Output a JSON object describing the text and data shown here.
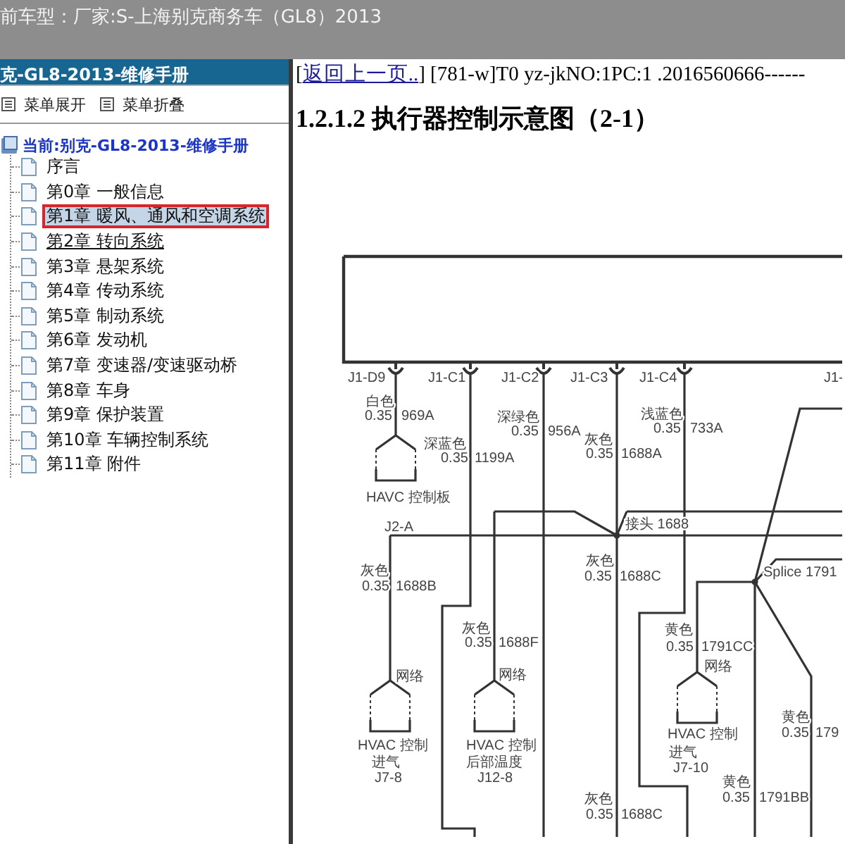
{
  "header": {
    "title": "前车型：厂家:S-上海别克商务车（GL8）2013"
  },
  "sidebar": {
    "title": "克-GL8-2013-维修手册",
    "toolbar": [
      {
        "label": "菜单展开"
      },
      {
        "label": "菜单折叠"
      }
    ],
    "tree": {
      "label": "当前:别克-GL8-2013-维修手册",
      "children": [
        {
          "label": "序言",
          "selected": false,
          "hovered": false
        },
        {
          "label": "第0章  一般信息",
          "selected": false,
          "hovered": false
        },
        {
          "label": "第1章  暖风、通风和空调系统",
          "selected": true,
          "hovered": false
        },
        {
          "label": "第2章  转向系统",
          "selected": false,
          "hovered": true
        },
        {
          "label": "第3章  悬架系统",
          "selected": false,
          "hovered": false
        },
        {
          "label": "第4章  传动系统",
          "selected": false,
          "hovered": false
        },
        {
          "label": "第5章  制动系统",
          "selected": false,
          "hovered": false
        },
        {
          "label": "第6章  发动机",
          "selected": false,
          "hovered": false
        },
        {
          "label": "第7章  变速器/变速驱动桥",
          "selected": false,
          "hovered": false
        },
        {
          "label": "第8章  车身",
          "selected": false,
          "hovered": false
        },
        {
          "label": "第9章  保护装置",
          "selected": false,
          "hovered": false
        },
        {
          "label": "第10章  车辆控制系统",
          "selected": false,
          "hovered": false
        },
        {
          "label": "第11章  附件",
          "selected": false,
          "hovered": false
        }
      ]
    }
  },
  "content": {
    "prefix": "[",
    "back_link": "返回上一页..",
    "ref": "] [781-w]T0 yz-jkNO:1PC:1 .2016560666------",
    "heading": "1.2.1.2 执行器控制示意图（2-1）",
    "diagram": {
      "labels": [
        "J1-D9",
        "J1-C1",
        "J1-C2",
        "J1-C3",
        "J1-C4",
        "J1-",
        "白色",
        "0.35",
        "969A",
        "深蓝色",
        "0.35",
        "1199A",
        "深绿色",
        "0.35",
        "956A",
        "灰色",
        "0.35",
        "1688A",
        "浅蓝色",
        "0.35",
        "733A",
        "HAVC 控制板",
        "J2-A",
        "接头 1688",
        "灰色",
        "0.35",
        "1688B",
        "灰色",
        "0.35",
        "1688C",
        "Splice 1791",
        "灰色",
        "0.35",
        "1688F",
        "网络",
        "网络",
        "黄色",
        "0.35",
        "1791CC",
        "网络",
        "黄色",
        "0.35",
        "179",
        "HVAC 控制",
        "进气",
        "J7-8",
        "HVAC 控制",
        "后部温度",
        "J12-8",
        "HVAC 控制",
        "进气",
        "J7-10",
        "灰色",
        "0.35",
        "1688C",
        "黄色",
        "0.35",
        "1791BB"
      ]
    }
  }
}
